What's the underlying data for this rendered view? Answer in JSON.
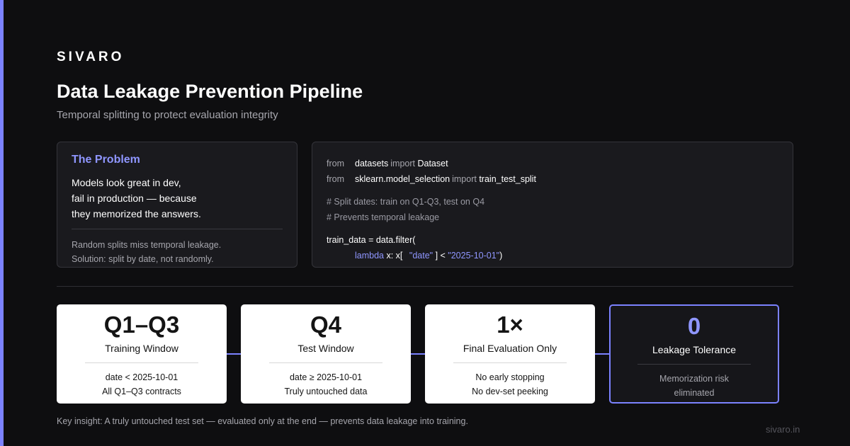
{
  "brand": "SIVARO",
  "title": "Data Leakage Prevention Pipeline",
  "subtitle": "Temporal splitting to protect evaluation integrity",
  "problem": {
    "title": "The Problem",
    "lines": [
      "Models look great in dev,",
      "fail in production — because",
      "they memorized the answers."
    ],
    "notes": [
      "Random splits miss temporal leakage.",
      "Solution: split by date, not randomly."
    ]
  },
  "code": {
    "import1": {
      "from": "from",
      "module": "datasets",
      "import": "import",
      "name": "Dataset"
    },
    "import2": {
      "from": "from",
      "module": "sklearn.model_selection",
      "import": "import",
      "name": "train_test_split"
    },
    "comment1": "# Split dates: train on Q1-Q3, test on Q4",
    "comment2": "# Prevents temporal leakage",
    "assign": "train_data = data.filter(",
    "lambda_kw": "lambda",
    "lambda_mid": " x: x[",
    "key": "\"date\"",
    "op": "] < ",
    "value": "\"2025-10-01\"",
    "close": ")"
  },
  "cards": [
    {
      "big": "Q1–Q3",
      "label": "Training Window",
      "notes": [
        "date < 2025-10-01",
        "All Q1–Q3 contracts"
      ]
    },
    {
      "big": "Q4",
      "label": "Test Window",
      "notes": [
        "date ≥ 2025-10-01",
        "Truly untouched data"
      ]
    },
    {
      "big": "1×",
      "label": "Final Evaluation Only",
      "notes": [
        "No early stopping",
        "No dev-set peeking"
      ]
    },
    {
      "big": "0",
      "label": "Leakage Tolerance",
      "notes": [
        "Memorization risk",
        "eliminated"
      ]
    }
  ],
  "insight": "Key insight: A truly untouched test set — evaluated only at the end — prevents data leakage into training.",
  "footer": "sivaro.in",
  "colors": {
    "accent": "#7b82ff",
    "background": "#0e0e10",
    "card_light": "#ffffff"
  },
  "icons": {
    "flow_arrow": "arrow-right-icon"
  }
}
